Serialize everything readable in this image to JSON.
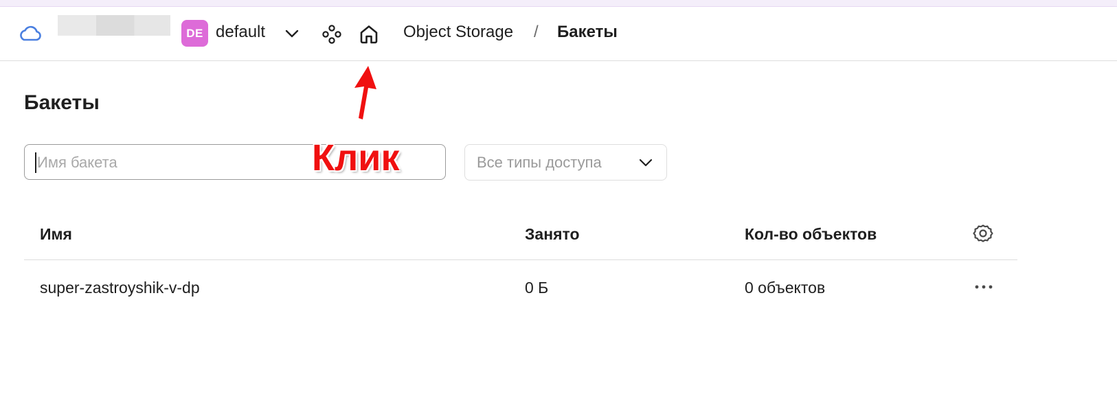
{
  "header": {
    "folder_badge": "DE",
    "folder_name": "default",
    "breadcrumb": {
      "service": "Object Storage",
      "separator": "/",
      "current": "Бакеты"
    }
  },
  "page": {
    "title": "Бакеты"
  },
  "filters": {
    "search_placeholder": "Имя бакета",
    "search_value": "",
    "access_type_selected": "Все типы доступа"
  },
  "table": {
    "columns": [
      "Имя",
      "Занято",
      "Кол-во объектов"
    ],
    "rows": [
      {
        "name": "super-zastroyshik-v-dp",
        "size": "0 Б",
        "objects": "0 объектов"
      }
    ]
  },
  "annotation": {
    "label": "Клик",
    "color": "#f01010"
  },
  "colors": {
    "folder_badge": "#dd6bd8",
    "cloud_icon": "#4a7fe0",
    "annotation": "#f01010"
  },
  "icons": {
    "cloud": "cloud-icon",
    "folder_chevron": "chevron-down-icon",
    "services": "services-icon",
    "home": "home-icon",
    "select_chevron": "chevron-down-icon",
    "settings": "gear-icon",
    "row_menu": "more-horizontal-icon",
    "annotation_arrow": "arrow-up-icon"
  }
}
